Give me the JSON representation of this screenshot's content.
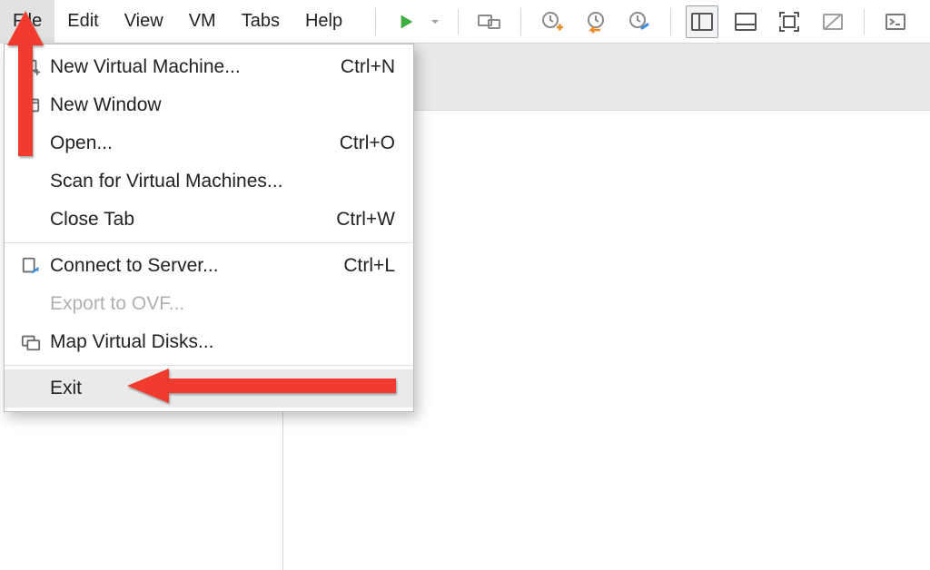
{
  "menubar": {
    "items": [
      "File",
      "Edit",
      "View",
      "VM",
      "Tabs",
      "Help"
    ],
    "open_index": 0
  },
  "file_menu": {
    "items": [
      {
        "icon": "screen-plus-icon",
        "label": "New Virtual Machine...",
        "shortcut": "Ctrl+N",
        "enabled": true
      },
      {
        "icon": "window-icon",
        "label": "New Window",
        "shortcut": "",
        "enabled": true
      },
      {
        "icon": "",
        "label": "Open...",
        "shortcut": "Ctrl+O",
        "enabled": true
      },
      {
        "icon": "",
        "label": "Scan for Virtual Machines...",
        "shortcut": "",
        "enabled": true
      },
      {
        "icon": "",
        "label": "Close Tab",
        "shortcut": "Ctrl+W",
        "enabled": true
      },
      {
        "separator": true
      },
      {
        "icon": "server-connect-icon",
        "label": "Connect to Server...",
        "shortcut": "Ctrl+L",
        "enabled": true
      },
      {
        "icon": "",
        "label": "Export to OVF...",
        "shortcut": "",
        "enabled": false
      },
      {
        "icon": "disks-icon",
        "label": "Map Virtual Disks...",
        "shortcut": "",
        "enabled": true
      },
      {
        "separator": true
      },
      {
        "icon": "",
        "label": "Exit",
        "shortcut": "",
        "enabled": true,
        "highlight": true
      }
    ]
  },
  "annotation": {
    "color": "#f03a2d"
  }
}
